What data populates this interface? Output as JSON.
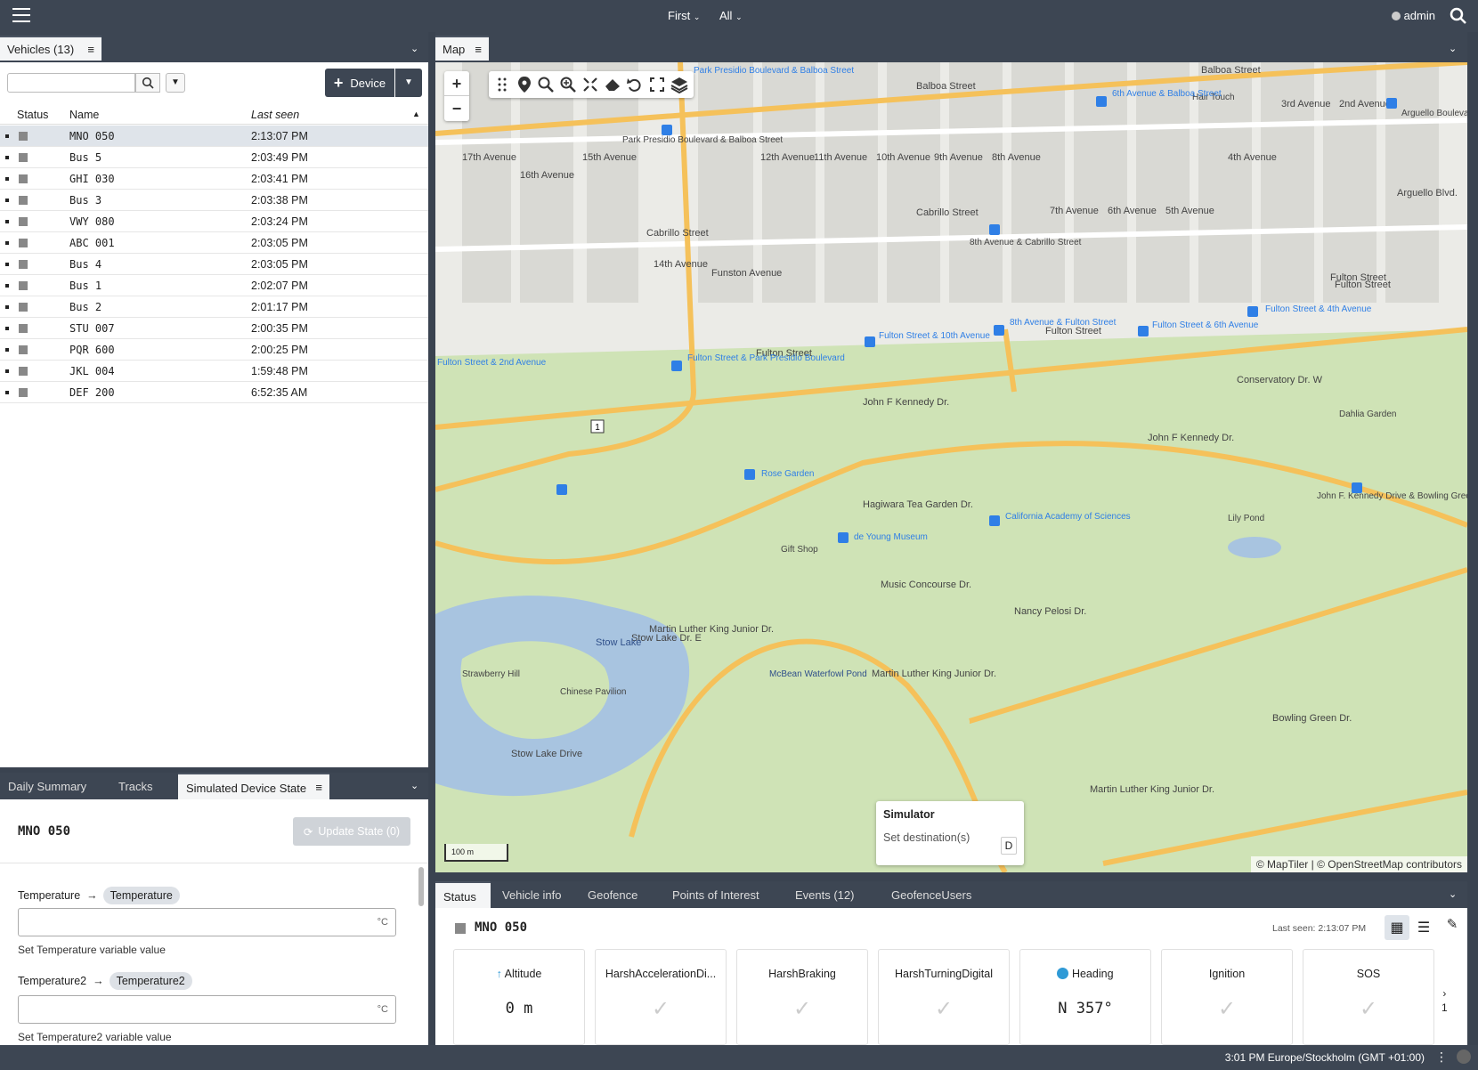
{
  "topbar": {
    "first_label": "First",
    "all_label": "All",
    "user_label": "admin",
    "menu_icon": "hamburger-icon",
    "search_icon": "search-icon"
  },
  "vehicles": {
    "tab_label": "Vehicles (13)",
    "search_placeholder": "",
    "device_button": "Device",
    "columns": [
      "Status",
      "Name",
      "Last seen"
    ],
    "rows": [
      {
        "name": "MNO 050",
        "last_seen": "2:13:07 PM"
      },
      {
        "name": "Bus 5",
        "last_seen": "2:03:49 PM"
      },
      {
        "name": "GHI 030",
        "last_seen": "2:03:41 PM"
      },
      {
        "name": "Bus 3",
        "last_seen": "2:03:38 PM"
      },
      {
        "name": "VWY 080",
        "last_seen": "2:03:24 PM"
      },
      {
        "name": "ABC 001",
        "last_seen": "2:03:05 PM"
      },
      {
        "name": "Bus 4",
        "last_seen": "2:03:05 PM"
      },
      {
        "name": "Bus 1",
        "last_seen": "2:02:07 PM"
      },
      {
        "name": "Bus 2",
        "last_seen": "2:01:17 PM"
      },
      {
        "name": "STU 007",
        "last_seen": "2:00:35 PM"
      },
      {
        "name": "PQR 600",
        "last_seen": "2:00:25 PM"
      },
      {
        "name": "JKL 004",
        "last_seen": "1:59:48 PM"
      },
      {
        "name": "DEF 200",
        "last_seen": "6:52:35 AM"
      }
    ]
  },
  "map": {
    "tab_label": "Map",
    "zoom_in": "+",
    "zoom_out": "−",
    "scale_label": "100 m",
    "attribution": "© MapTiler | © OpenStreetMap contributors",
    "route_shield": "1",
    "streets": [
      "Balboa Street",
      "Balboa Street",
      "Cabrillo Street",
      "Cabrillo Street",
      "Fulton Street",
      "Fulton Street",
      "Fulton Street",
      "Fulton Street",
      "John F Kennedy Dr.",
      "John F Kennedy Dr.",
      "Martin Luther King Junior Dr.",
      "Martin Luther King Junior Dr.",
      "Martin Luther King Junior Dr.",
      "Stow Lake Drive",
      "Stow Lake Dr. E",
      "Nancy Pelosi Dr.",
      "Hagiwara Tea Garden Dr.",
      "Music Concourse Dr.",
      "Conservatory Dr. W",
      "Bowling Green Dr.",
      "Arguello Blvd.",
      "17th Avenue",
      "16th Avenue",
      "15th Avenue",
      "14th Avenue",
      "12th Avenue",
      "11th Avenue",
      "10th Avenue",
      "9th Avenue",
      "8th Avenue",
      "7th Avenue",
      "6th Avenue",
      "5th Avenue",
      "4th Avenue",
      "3rd Avenue",
      "2nd Avenue",
      "Funston Avenue",
      "Fulton Street & 4th Avenue",
      "Fulton Street & 6th Avenue"
    ],
    "places": [
      "Stow Lake",
      "Strawberry Hill",
      "Chinese Pavilion",
      "McBean Waterfowl Pond",
      "Gift Shop",
      "Lily Pond",
      "Dahlia Garden",
      "Hair Touch",
      "Rose Garden",
      "de Young Museum",
      "California Academy of Sciences",
      "Park Presidio Boulevard & Balboa Street",
      "Park Presidio Boulevard & Balboa Street",
      "6th Avenue & Balboa Street",
      "8th Avenue & Cabrillo Street",
      "Fulton Street & 10th Avenue",
      "8th Avenue & Fulton Street",
      "Fulton Street & Park Presidio Boulevard",
      "John F. Kennedy Drive & Bowling Green Drive",
      "Arguello Boulevard & Balboa Street",
      "Fulton Street & 2nd Avenue"
    ],
    "simulator": {
      "title": "Simulator",
      "label": "Set destination(s)",
      "key": "D"
    }
  },
  "bottom_left": {
    "tabs": [
      "Daily Summary",
      "Tracks",
      "Simulated Device State"
    ],
    "device_name": "MNO 050",
    "update_button": "Update State (0)",
    "vars": [
      {
        "name": "Temperature",
        "chip": "Temperature",
        "unit": "°C",
        "help": "Set Temperature variable value"
      },
      {
        "name": "Temperature2",
        "chip": "Temperature2",
        "unit": "°C",
        "help": "Set Temperature2 variable value"
      }
    ]
  },
  "bottom_right": {
    "tabs": [
      "Status",
      "Vehicle info",
      "Geofence",
      "Points of Interest",
      "Events (12)",
      "GeofenceUsers"
    ],
    "device_name": "MNO 050",
    "last_seen": "Last seen: 2:13:07 PM",
    "cards": [
      {
        "label": "Altitude",
        "value": "0 m",
        "icon": "arrow-up-icon"
      },
      {
        "label": "HarshAccelerationDi...",
        "value": "✓"
      },
      {
        "label": "HarshBraking",
        "value": "✓"
      },
      {
        "label": "HarshTurningDigital",
        "value": "✓"
      },
      {
        "label": "Heading",
        "value": "N 357°",
        "icon": "compass-icon"
      },
      {
        "label": "Ignition",
        "value": "✓"
      },
      {
        "label": "SOS",
        "value": "✓"
      }
    ],
    "pager": {
      "arrow": "›",
      "page": "1"
    }
  },
  "statusbar": {
    "timezone": "3:01 PM Europe/Stockholm (GMT +01:00)"
  },
  "colors": {
    "chrome": "#3d4653",
    "map_park": "#cfe3b6",
    "map_road": "#f5c15a",
    "water": "#a8c4e0",
    "transit": "#2f7fe6"
  }
}
